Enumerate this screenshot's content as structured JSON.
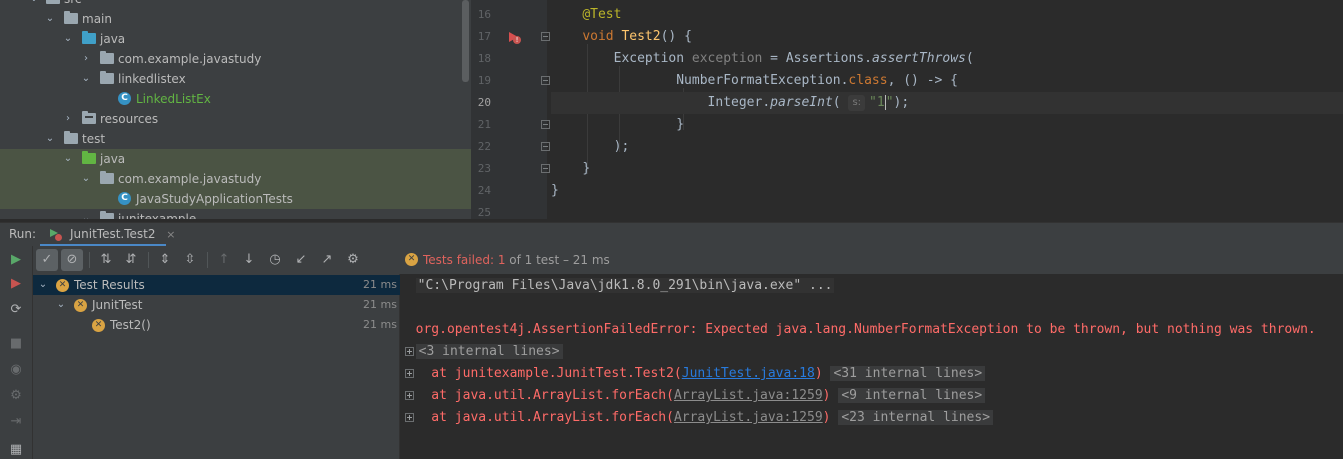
{
  "tree": {
    "items": [
      {
        "label": "src",
        "icon": "folder-icon"
      },
      {
        "label": "main",
        "icon": "folder-icon"
      },
      {
        "label": "java",
        "icon": "source-folder-icon"
      },
      {
        "label": "com.example.javastudy",
        "icon": "package-icon"
      },
      {
        "label": "linkedlistex",
        "icon": "package-icon"
      },
      {
        "label": "LinkedListEx",
        "icon": "class-icon"
      },
      {
        "label": "resources",
        "icon": "resources-folder-icon"
      },
      {
        "label": "test",
        "icon": "folder-icon"
      },
      {
        "label": "java",
        "icon": "test-source-folder-icon"
      },
      {
        "label": "com.example.javastudy",
        "icon": "package-icon"
      },
      {
        "label": "JavaStudyApplicationTests",
        "icon": "class-icon"
      },
      {
        "label": "junitexample",
        "icon": "package-icon"
      }
    ]
  },
  "editor": {
    "line_numbers": [
      "16",
      "17",
      "18",
      "19",
      "20",
      "21",
      "22",
      "23",
      "24",
      "25"
    ],
    "current_line": "20",
    "code": {
      "l16_ann": "@Test",
      "l17_kw": "void",
      "l17_fn": "Test2",
      "l17_rest": "() {",
      "l18_type": "Exception",
      "l18_var": "exception",
      "l18_eq": " = Assertions.",
      "l18_call": "assertThrows",
      "l18_paren": "(",
      "l19_cls": "NumberFormatException.",
      "l19_kw": "class",
      "l19_rest": ", () -> {",
      "l20_obj": "Integer.",
      "l20_call": "parseInt",
      "l20_open": "( ",
      "l20_hint": "s:",
      "l20_str1": "\"1",
      "l20_str2": "\"",
      "l20_end": ");",
      "l21": "}",
      "l22": ");",
      "l23": "}",
      "l24": "}"
    }
  },
  "run_panel": {
    "label": "Run:",
    "tab_label": "JunitTest.Test2",
    "tab_close": "×",
    "status": {
      "failed_text": "Tests failed: ",
      "failed_count": "1",
      "of_text": " of 1 test – 21 ms"
    },
    "results": [
      {
        "label": "Test Results",
        "duration": "21 ms"
      },
      {
        "label": "JunitTest",
        "duration": "21 ms"
      },
      {
        "label": "Test2()",
        "duration": "21 ms"
      }
    ],
    "console": {
      "cmd": "\"C:\\Program Files\\Java\\jdk1.8.0_291\\bin\\java.exe\" ...",
      "error": "org.opentest4j.AssertionFailedError: Expected java.lang.NumberFormatException to be thrown, but nothing was thrown.",
      "internal1": "<3 internal lines>",
      "at1_prefix": "    at junitexample.JunitTest.Test2(",
      "at1_link": "JunitTest.java:18",
      "at1_suffix": ")",
      "at1_fold": "<31 internal lines>",
      "at2_prefix": "    at java.util.ArrayList.forEach(",
      "at2_link": "ArrayList.java:1259",
      "at2_suffix": ")",
      "at2_fold": "<9 internal lines>",
      "at3_prefix": "    at java.util.ArrayList.forEach(",
      "at3_link": "ArrayList.java:1259",
      "at3_suffix": ")",
      "at3_fold": "<23 internal lines>"
    }
  },
  "colors": {
    "accent": "#4a88c7",
    "error": "#ff6b68",
    "warning": "#d9a343",
    "selection": "#0d293e"
  }
}
